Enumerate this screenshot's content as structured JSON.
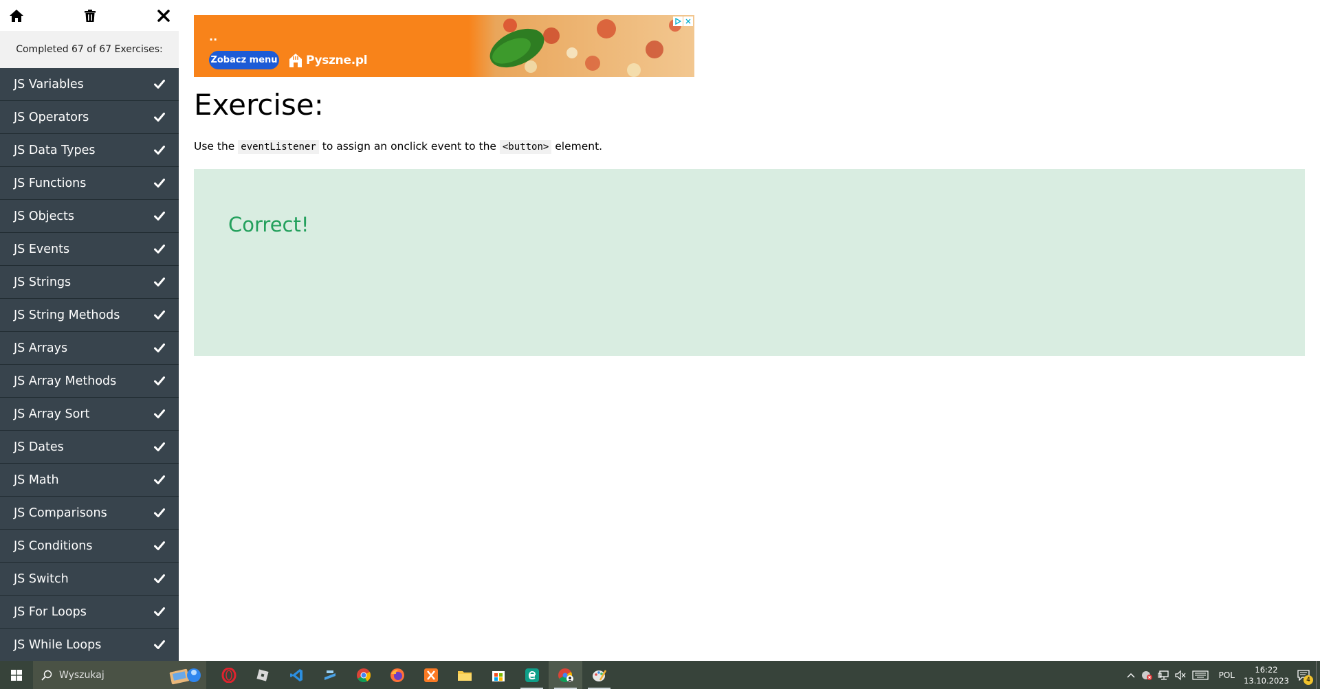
{
  "sidebar": {
    "progress_text": "Completed 67 of 67 Exercises:",
    "topics": [
      {
        "label": "JS Variables"
      },
      {
        "label": "JS Operators"
      },
      {
        "label": "JS Data Types"
      },
      {
        "label": "JS Functions"
      },
      {
        "label": "JS Objects"
      },
      {
        "label": "JS Events"
      },
      {
        "label": "JS Strings"
      },
      {
        "label": "JS String Methods"
      },
      {
        "label": "JS Arrays"
      },
      {
        "label": "JS Array Methods"
      },
      {
        "label": "JS Array Sort"
      },
      {
        "label": "JS Dates"
      },
      {
        "label": "JS Math"
      },
      {
        "label": "JS Comparisons"
      },
      {
        "label": "JS Conditions"
      },
      {
        "label": "JS Switch"
      },
      {
        "label": "JS For Loops"
      },
      {
        "label": "JS While Loops"
      }
    ]
  },
  "ad": {
    "dots": "..",
    "button_label": "Zobacz menu",
    "brand": "Pyszne.pl"
  },
  "exercise": {
    "title": "Exercise:",
    "desc_part1": "Use the",
    "code1": "eventListener",
    "desc_part2": "to assign an onclick event to the",
    "code2": "<button>",
    "desc_part3": "element.",
    "result": "Correct!"
  },
  "taskbar": {
    "search_placeholder": "Wyszukaj",
    "language": "POL",
    "time": "16:22",
    "date": "13.10.2023",
    "notification_count": "4",
    "apps": [
      "opera-icon",
      "roblox-icon",
      "vscode-icon",
      "tool-icon",
      "chrome-icon",
      "firefox-icon",
      "xampp-icon",
      "file-explorer-icon",
      "store-icon",
      "edge-icon",
      "chrome-profile-icon",
      "paint-icon"
    ]
  },
  "colors": {
    "sidebar_bg": "#38444d",
    "result_bg": "#d9ede1",
    "result_text": "#23a05c",
    "ad_bg": "#f8831a"
  }
}
